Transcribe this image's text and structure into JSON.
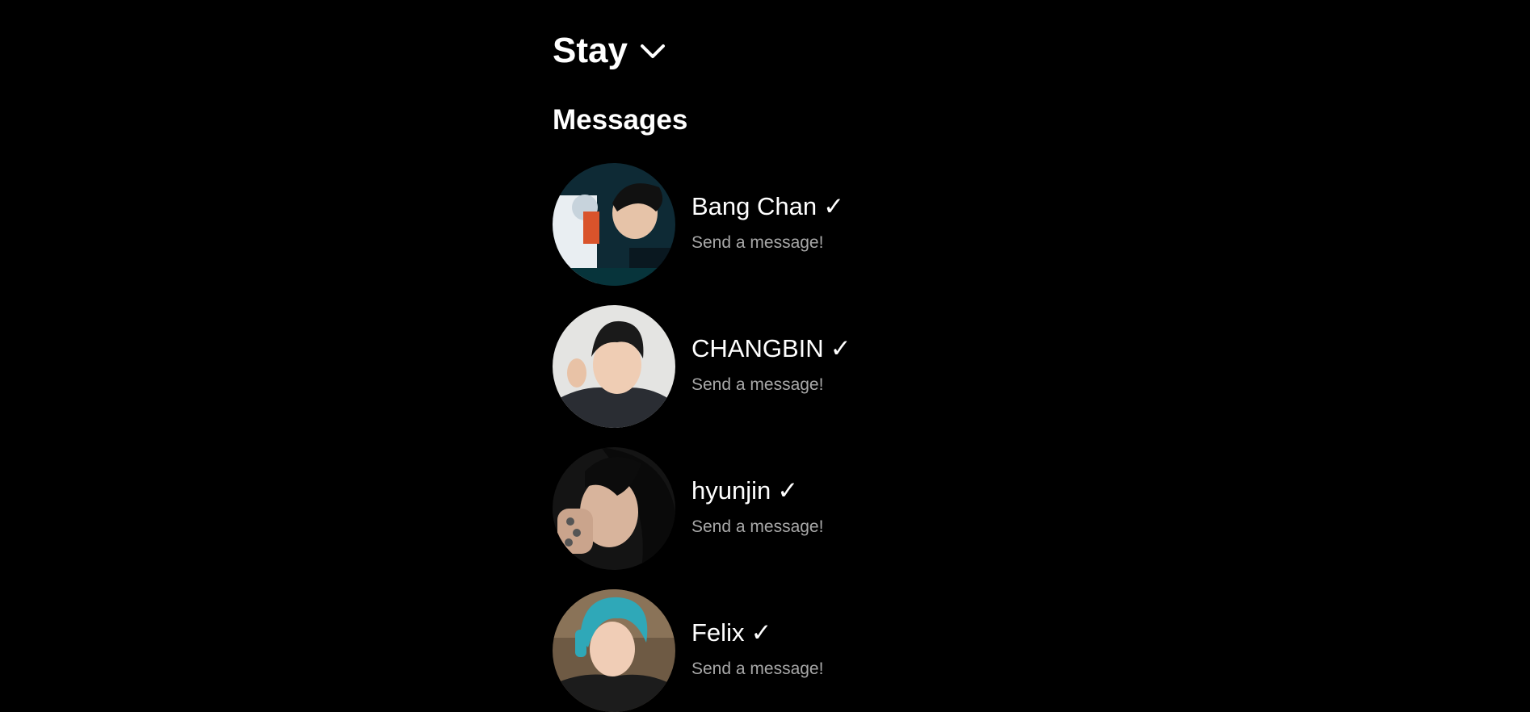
{
  "account": {
    "name": "Stay",
    "switch_icon": "chevron-down-icon"
  },
  "messages": {
    "title": "Messages",
    "threads": [
      {
        "name": "Bang Chan",
        "verified": "✓",
        "preview": "Send a message!"
      },
      {
        "name": "CHANGBIN",
        "verified": "✓",
        "preview": "Send a message!"
      },
      {
        "name": "hyunjin",
        "verified": "✓",
        "preview": "Send a message!"
      },
      {
        "name": "Felix",
        "verified": "✓",
        "preview": "Send a message!"
      }
    ]
  },
  "colors": {
    "background": "#000000",
    "primary_text": "#ffffff",
    "secondary_text": "#a8a8a8"
  }
}
